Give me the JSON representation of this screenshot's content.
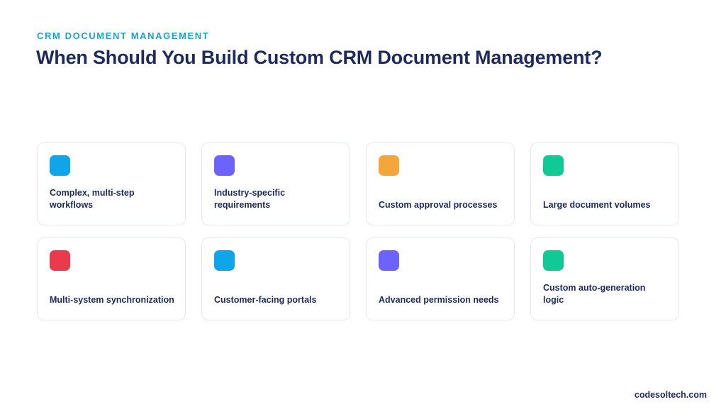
{
  "header": {
    "eyebrow": "CRM DOCUMENT MANAGEMENT",
    "title": "When Should You Build Custom CRM Document Management?"
  },
  "cards": [
    {
      "label": "Complex, multi-step workflows",
      "color": "#0ea5e9"
    },
    {
      "label": "Industry-specific requirements",
      "color": "#6c63ff"
    },
    {
      "label": "Custom approval processes",
      "color": "#f5a63a"
    },
    {
      "label": "Large document volumes",
      "color": "#10c995"
    },
    {
      "label": "Multi-system synchronization",
      "color": "#e83b4c"
    },
    {
      "label": "Customer-facing portals",
      "color": "#0ea5e9"
    },
    {
      "label": "Advanced permission needs",
      "color": "#6c63ff"
    },
    {
      "label": "Custom auto-generation logic",
      "color": "#10c995"
    }
  ],
  "footer": {
    "brand": "codesoltech.com"
  }
}
